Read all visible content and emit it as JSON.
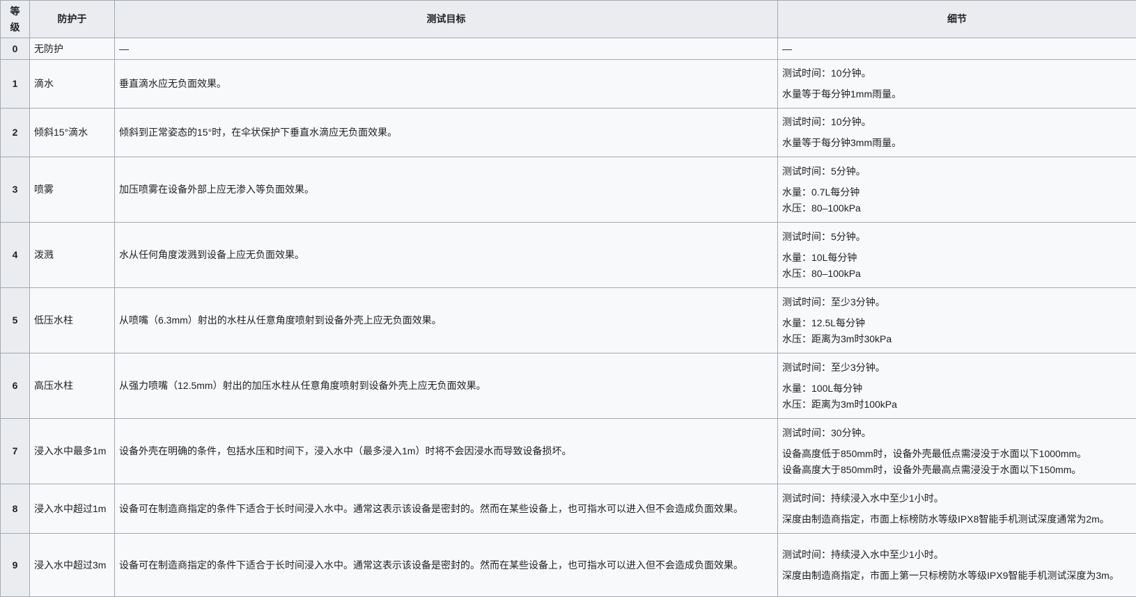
{
  "headers": {
    "level": "等级",
    "protect": "防护于",
    "target": "测试目标",
    "detail": "细节"
  },
  "rows": [
    {
      "level": "0",
      "protect": "无防护",
      "target": "—",
      "details": [
        [
          "—"
        ]
      ]
    },
    {
      "level": "1",
      "protect": "滴水",
      "target": "垂直滴水应无负面效果。",
      "details": [
        [
          "测试时间：10分钟。"
        ],
        [
          "水量等于每分钟1mm雨量。"
        ]
      ]
    },
    {
      "level": "2",
      "protect": "倾斜15°滴水",
      "target": "倾斜到正常姿态的15°时，在伞状保护下垂直水滴应无负面效果。",
      "details": [
        [
          "测试时间：10分钟。"
        ],
        [
          "水量等于每分钟3mm雨量。"
        ]
      ]
    },
    {
      "level": "3",
      "protect": "喷雾",
      "target": "加压喷雾在设备外部上应无渗入等负面效果。",
      "details": [
        [
          "测试时间：5分钟。"
        ],
        [
          "水量：0.7L每分钟",
          "水压：80–100kPa"
        ]
      ]
    },
    {
      "level": "4",
      "protect": "泼溅",
      "target": "水从任何角度泼溅到设备上应无负面效果。",
      "details": [
        [
          "测试时间：5分钟。"
        ],
        [
          "水量：10L每分钟",
          "水压：80–100kPa"
        ]
      ]
    },
    {
      "level": "5",
      "protect": "低压水柱",
      "target": "从喷嘴（6.3mm）射出的水柱从任意角度喷射到设备外壳上应无负面效果。",
      "details": [
        [
          "测试时间：至少3分钟。"
        ],
        [
          "水量：12.5L每分钟",
          "水压：距离为3m时30kPa"
        ]
      ]
    },
    {
      "level": "6",
      "protect": "高压水柱",
      "target": "从强力喷嘴（12.5mm）射出的加压水柱从任意角度喷射到设备外壳上应无负面效果。",
      "details": [
        [
          "测试时间：至少3分钟。"
        ],
        [
          "水量：100L每分钟",
          "水压：距离为3m时100kPa"
        ]
      ]
    },
    {
      "level": "7",
      "protect": "浸入水中最多1m",
      "target": "设备外壳在明确的条件，包括水压和时间下，浸入水中（最多浸入1m）时将不会因浸水而导致设备损坏。",
      "details": [
        [
          "测试时间：30分钟。"
        ],
        [
          "设备高度低于850mm时，设备外壳最低点需浸没于水面以下1000mm。",
          "设备高度大于850mm时，设备外壳最高点需浸没于水面以下150mm。"
        ]
      ]
    },
    {
      "level": "8",
      "protect": "浸入水中超过1m",
      "target": "设备可在制造商指定的条件下适合于长时间浸入水中。通常这表示该设备是密封的。然而在某些设备上，也可指水可以进入但不会造成负面效果。",
      "details": [
        [
          "测试时间：持续浸入水中至少1小时。"
        ],
        [
          "深度由制造商指定，市面上标榜防水等级IPX8智能手机测试深度通常为2m。"
        ]
      ]
    },
    {
      "level": "9",
      "protect": "浸入水中超过3m",
      "target": "设备可在制造商指定的条件下适合于长时间浸入水中。通常这表示该设备是密封的。然而在某些设备上，也可指水可以进入但不会造成负面效果。",
      "details": [
        [
          "测试时间：持续浸入水中至少1小时。"
        ],
        [
          "深度由制造商指定，市面上第一只标榜防水等级IPX9智能手机测试深度为3m。"
        ]
      ]
    }
  ]
}
